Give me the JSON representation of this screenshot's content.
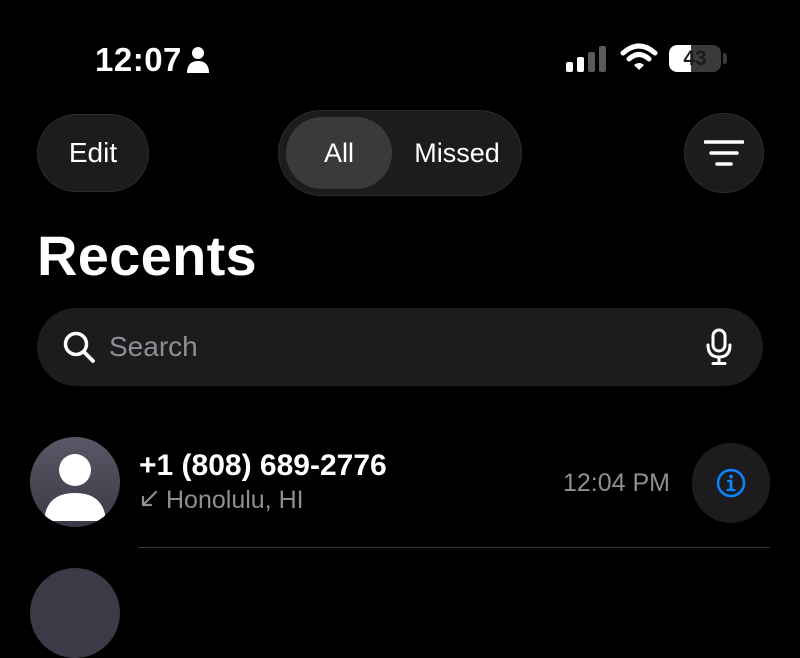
{
  "status_bar": {
    "time": "12:07",
    "battery_level": "43",
    "battery_fraction": 0.43
  },
  "toolbar": {
    "edit_label": "Edit",
    "segments": [
      {
        "label": "All",
        "selected": true
      },
      {
        "label": "Missed",
        "selected": false
      }
    ],
    "filter_icon": "filter-lines-icon"
  },
  "page": {
    "title": "Recents"
  },
  "search": {
    "placeholder": "Search",
    "value": "",
    "icon": "magnifying-glass-icon",
    "mic_icon": "microphone-icon"
  },
  "recents": [
    {
      "name": "+1 (808) 689-2776",
      "location": "Honolulu, HI",
      "time": "12:04 PM",
      "call_type_icon": "incoming-arrow-icon",
      "info_icon": "info-circle-icon"
    }
  ],
  "colors": {
    "background": "#000000",
    "control": "#1c1c1e",
    "selected_segment": "#3a3a3c",
    "secondary_text": "#8e8e93",
    "accent_blue": "#0a84ff"
  }
}
